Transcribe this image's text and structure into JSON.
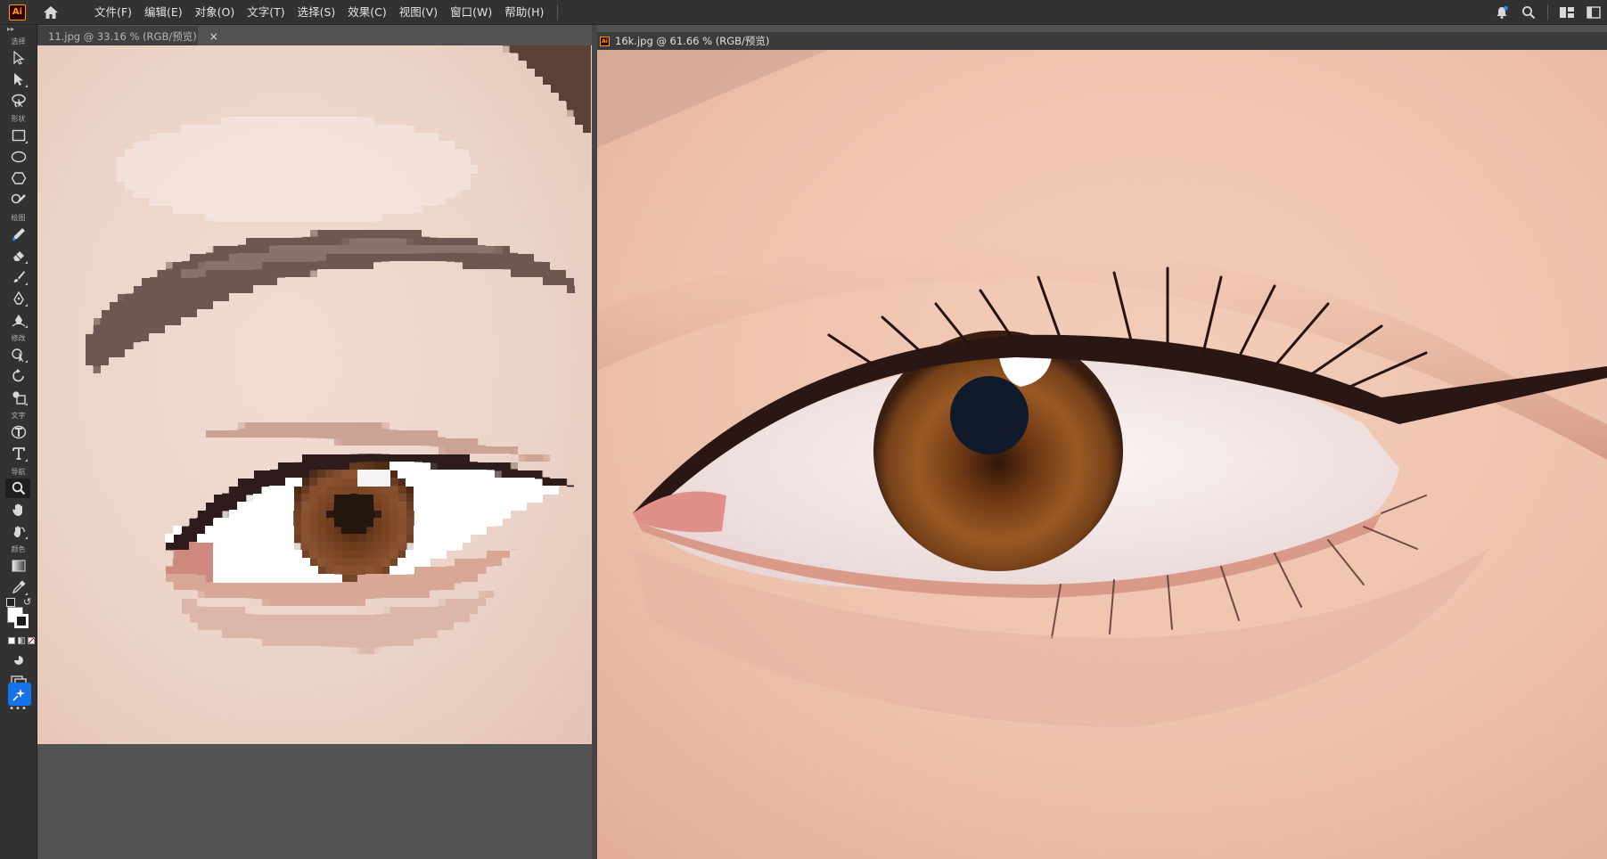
{
  "app": {
    "logo_text": "Ai",
    "menu": [
      "文件(F)",
      "编辑(E)",
      "对象(O)",
      "文字(T)",
      "选择(S)",
      "效果(C)",
      "视图(V)",
      "窗口(W)",
      "帮助(H)"
    ]
  },
  "toolbar": {
    "groups": {
      "select": "选择",
      "shape": "形状",
      "draw": "绘图",
      "modify": "修改",
      "text": "文字",
      "navigate": "导航",
      "color": "颜色"
    },
    "more_label": "•••"
  },
  "documents": [
    {
      "tab_label": "11.jpg @ 33.16 % (RGB/预览)",
      "close_glyph": "×",
      "active": false
    },
    {
      "tab_label": "16k.jpg @ 61.66 % (RGB/预览)",
      "active": true
    }
  ],
  "colors": {
    "chrome_dark": "#323232",
    "workspace": "#535353",
    "accent_blue": "#1473e6",
    "brand_orange": "#ff9a00"
  }
}
